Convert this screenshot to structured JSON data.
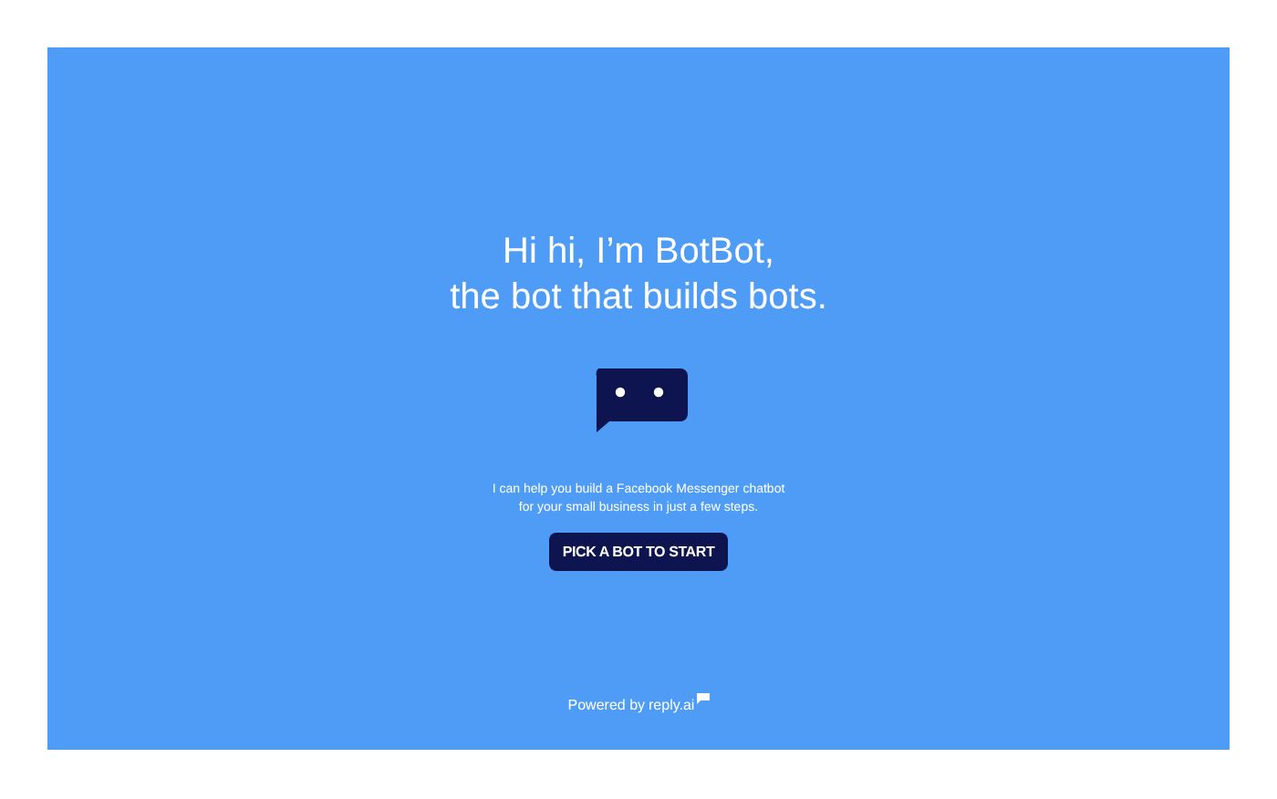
{
  "headline": [
    "Hi hi, I’m BotBot,",
    "the bot that builds bots."
  ],
  "intro": [
    "I can help you build a Facebook Messenger chatbot",
    "for your small business in just a few steps."
  ],
  "start_button": {
    "label": "PICK A BOT TO START"
  },
  "footer": {
    "powered_by": "Powered by",
    "brand": "reply.ai"
  }
}
